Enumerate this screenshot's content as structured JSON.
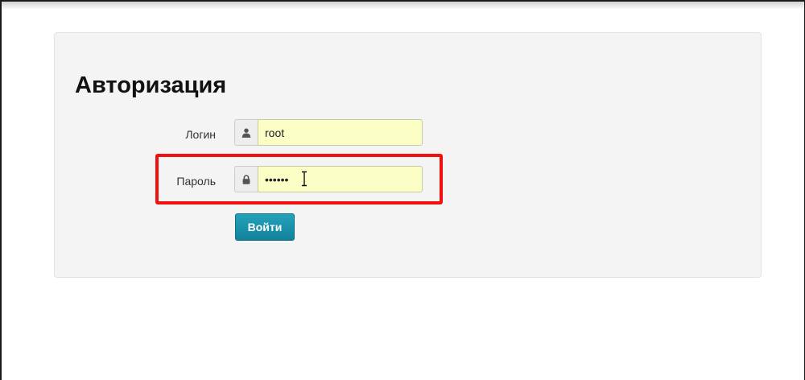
{
  "form": {
    "title": "Авторизация",
    "login_label": "Логин",
    "login_value": "root",
    "password_label": "Пароль",
    "password_value": "••••••",
    "submit_label": "Войти"
  },
  "icons": {
    "login_addon": "user-icon",
    "password_addon": "lock-icon",
    "text_cursor": "text-cursor-icon"
  },
  "colors": {
    "highlight": "#f01010",
    "button": "#1a8ea5",
    "field_background": "#fbffc6",
    "panel_background": "#f4f4f4"
  }
}
